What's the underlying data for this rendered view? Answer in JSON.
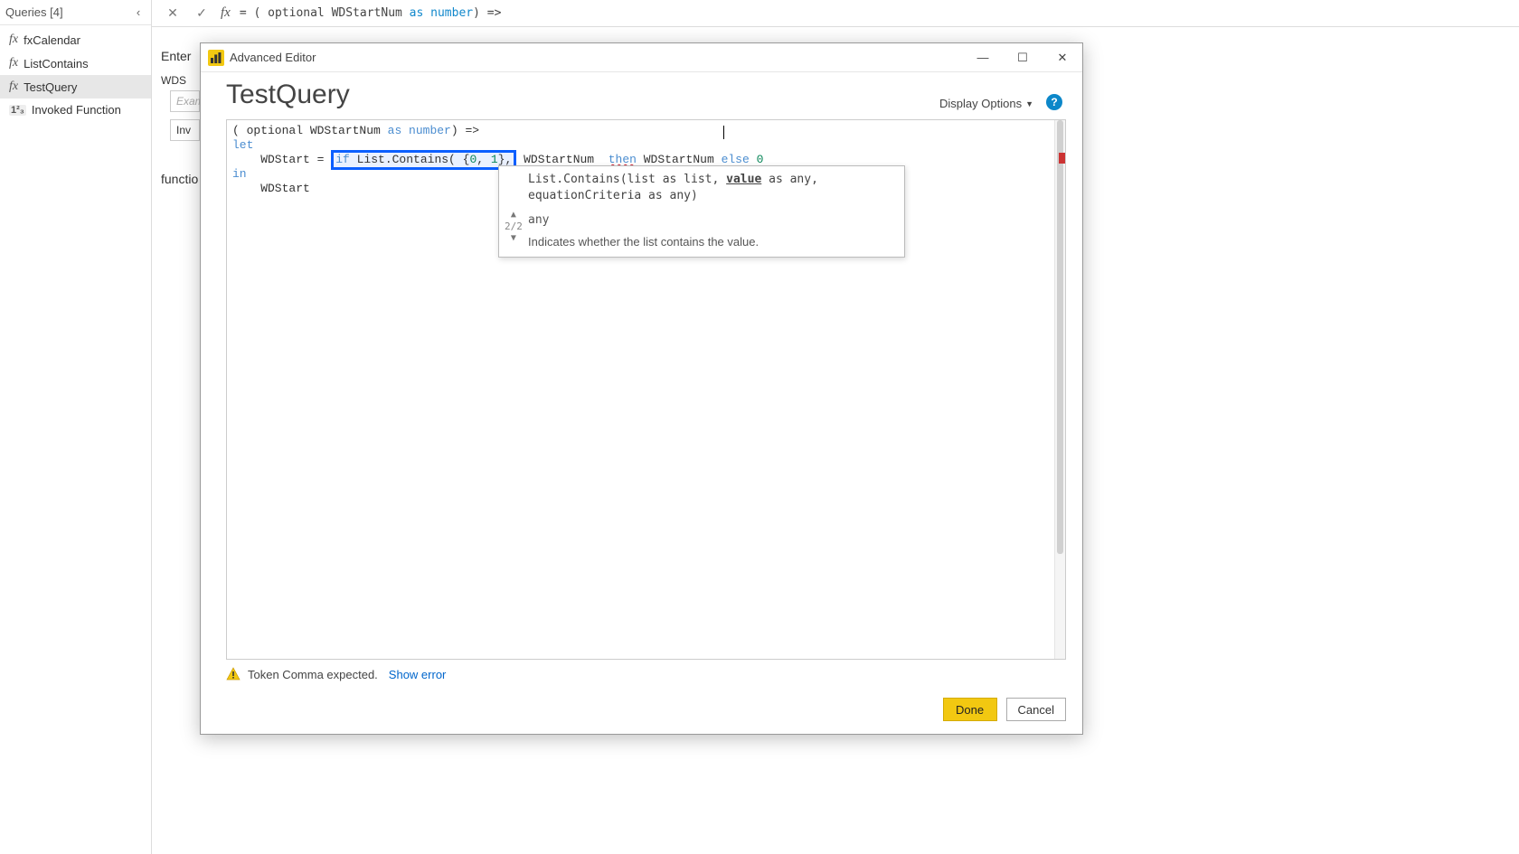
{
  "sidebar": {
    "title": "Queries [4]",
    "items": [
      {
        "icon": "fx",
        "label": "fxCalendar"
      },
      {
        "icon": "fx",
        "label": "ListContains"
      },
      {
        "icon": "fx",
        "label": "TestQuery",
        "selected": true
      },
      {
        "icon": "123",
        "label": "Invoked Function"
      }
    ]
  },
  "formula_bar": {
    "prefix": "= ( optional WDStartNum ",
    "kw_as": "as",
    "kw_number": "number",
    "suffix": ") =>"
  },
  "behind": {
    "enter": "Enter",
    "wdstart": "WDS",
    "example": "Exam",
    "invoke": "Inv",
    "function": "functio"
  },
  "dialog": {
    "title": "Advanced Editor",
    "query_name": "TestQuery",
    "display_options": "Display Options",
    "code": {
      "line1_a": "( optional WDStartNum ",
      "line1_as": "as",
      "line1_num": " number",
      "line1_b": ") =>",
      "line2": "let",
      "line3_a": "    WDStart = ",
      "line3_hl": "if List.Contains( {0, 1},",
      "line3_b": " WDStartNum  ",
      "line3_then": "then",
      "line3_c": " WDStartNum ",
      "line3_else": "else",
      "line3_zero": " 0",
      "line4": "in",
      "line5": "    WDStart"
    },
    "intellisense": {
      "sig1": "List.Contains(list as list, ",
      "sig_value": "value",
      "sig2": " as any, equationCriteria as any)",
      "ret": "any",
      "desc": "Indicates whether the list contains the value.",
      "count": "2/2"
    },
    "status": {
      "text": "Token Comma expected.",
      "link": "Show error"
    },
    "buttons": {
      "done": "Done",
      "cancel": "Cancel"
    }
  }
}
